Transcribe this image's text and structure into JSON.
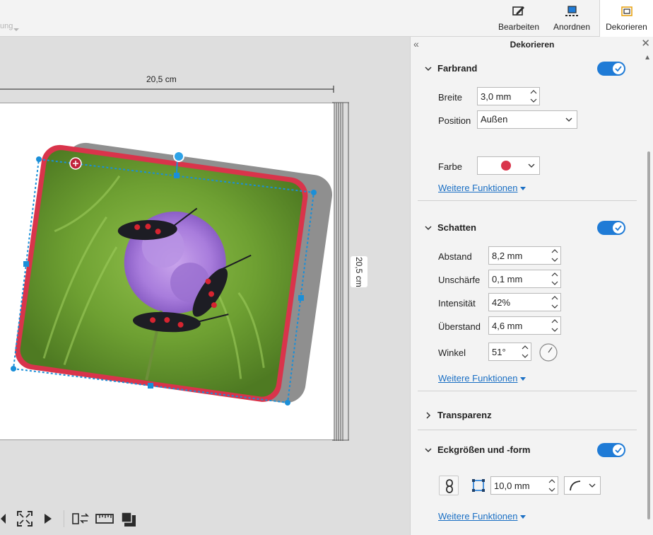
{
  "toolbar": {
    "faded_label": "ung",
    "buttons": [
      {
        "label": "Bearbeiten",
        "icon": "edit-icon"
      },
      {
        "label": "Anordnen",
        "icon": "arrange-icon"
      },
      {
        "label": "Dekorieren",
        "icon": "decorate-icon",
        "active": true
      }
    ]
  },
  "canvas": {
    "width_label": "20,5 cm",
    "height_label": "20,5 cm"
  },
  "panel": {
    "title": "Dekorieren",
    "sections": {
      "farbrand": {
        "title": "Farbrand",
        "enabled": true,
        "breite_label": "Breite",
        "breite_value": "3,0 mm",
        "position_label": "Position",
        "position_value": "Außen",
        "farbe_label": "Farbe",
        "farbe_color": "#d9344b",
        "link": "Weitere Funktionen"
      },
      "schatten": {
        "title": "Schatten",
        "enabled": true,
        "abstand_label": "Abstand",
        "abstand_value": "8,2 mm",
        "unschaerfe_label": "Unschärfe",
        "unschaerfe_value": "0,1 mm",
        "intensitaet_label": "Intensität",
        "intensitaet_value": "42%",
        "ueberstand_label": "Überstand",
        "ueberstand_value": "4,6 mm",
        "winkel_label": "Winkel",
        "winkel_value": "51°",
        "link": "Weitere Funktionen"
      },
      "transparenz": {
        "title": "Transparenz"
      },
      "ecken": {
        "title": "Eckgrößen und -form",
        "enabled": true,
        "size_value": "10,0 mm",
        "link": "Weitere Funktionen"
      }
    }
  },
  "colors": {
    "accent": "#1f7bd6",
    "frame": "#d9344b",
    "selection": "#1a8fd8"
  }
}
